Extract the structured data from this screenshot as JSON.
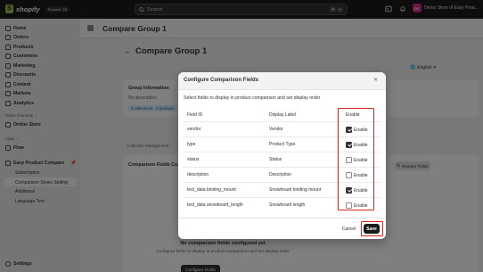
{
  "topbar": {
    "logo_text": "shopify",
    "edition_badge": "Summer '25",
    "search_placeholder": "Search",
    "search_shortcut_1": "⌘",
    "search_shortcut_2": "K",
    "store_initials": "DC",
    "store_name": "Demo Store of Easy Prod..."
  },
  "sidebar": {
    "items": [
      {
        "label": "Home",
        "icon": "home-icon"
      },
      {
        "label": "Orders",
        "icon": "orders-icon"
      },
      {
        "label": "Products",
        "icon": "products-icon"
      },
      {
        "label": "Customers",
        "icon": "customers-icon"
      },
      {
        "label": "Marketing",
        "icon": "marketing-icon"
      },
      {
        "label": "Discounts",
        "icon": "discounts-icon"
      },
      {
        "label": "Content",
        "icon": "content-icon"
      },
      {
        "label": "Markets",
        "icon": "markets-icon"
      },
      {
        "label": "Analytics",
        "icon": "analytics-icon"
      }
    ],
    "sales_channels_label": "Sales channels",
    "online_store_label": "Online Store",
    "apps_label": "Apps",
    "flow_label": "Flow",
    "app_name": "Easy Product Compare",
    "app_subitems": [
      "Subscription",
      "Comparison Styles Setting",
      "Additional",
      "Language Test"
    ],
    "settings_label": "Settings"
  },
  "main": {
    "breadcrumb_title": "Compare Group 1",
    "page_title": "Compare Group 1",
    "language_selector": "English",
    "group_info_title": "Group Information",
    "group_info_desc": "No description",
    "tag_collections": "1 collections",
    "tag_products": "0 products",
    "tab_label": "Collection Management",
    "fields_card_title": "Comparison Fields Co...",
    "reorder_label": "Reorder Fields",
    "empty_title": "No comparison fields configured yet",
    "empty_desc": "Configure fields to display in product comparison and set display order",
    "configure_button": "Configure Fields"
  },
  "modal": {
    "title": "Configure Comparison Fields",
    "description": "Select fields to display in product comparison and set display order",
    "headers": {
      "field_id": "Field ID",
      "display_label": "Display Label",
      "enable": "Enable"
    },
    "rows": [
      {
        "field_id": "vendor",
        "display_label": "Vendor",
        "enabled": true,
        "enable_label": "Enable"
      },
      {
        "field_id": "type",
        "display_label": "Product Type",
        "enabled": true,
        "enable_label": "Enable"
      },
      {
        "field_id": "status",
        "display_label": "Status",
        "enabled": false,
        "enable_label": "Enable"
      },
      {
        "field_id": "description",
        "display_label": "Description",
        "enabled": false,
        "enable_label": "Enable"
      },
      {
        "field_id": "test_data.binding_mount",
        "display_label": "Snowboard binding mount",
        "enabled": true,
        "enable_label": "Enable"
      },
      {
        "field_id": "test_data.snowboard_length",
        "display_label": "Snowboard length",
        "enabled": false,
        "enable_label": "Enable"
      }
    ],
    "cancel_label": "Cancel",
    "save_label": "Save",
    "close_icon": "close-icon"
  },
  "colors": {
    "highlight": "#e02424",
    "primary_button": "#1a1a1a",
    "topbar": "#1a1a1a"
  }
}
